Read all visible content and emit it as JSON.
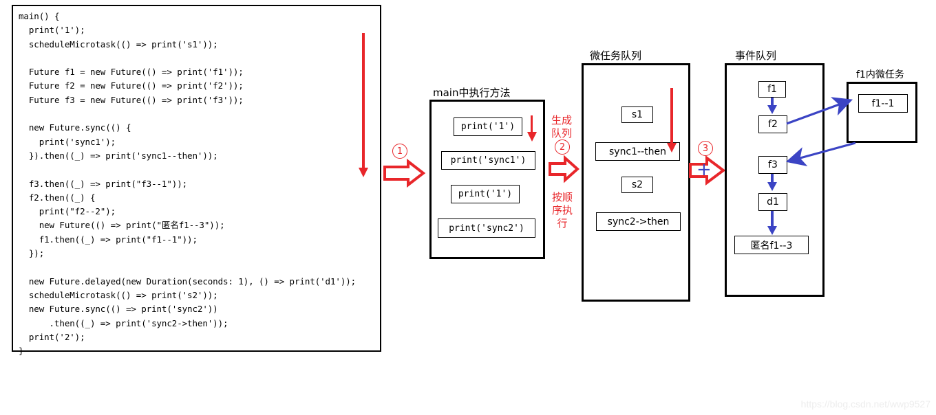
{
  "code_panel": {
    "name": "dart-event-loop-source-code",
    "code": "main() {\n  print('1');\n  scheduleMicrotask(() => print('s1'));\n\n  Future f1 = new Future(() => print('f1'));\n  Future f2 = new Future(() => print('f2'));\n  Future f3 = new Future(() => print('f3'));\n\n  new Future.sync(() {\n    print('sync1');\n  }).then((_) => print('sync1--then'));\n\n  f3.then((_) => print(\"f3--1\"));\n  f2.then((_) {\n    print(\"f2--2\");\n    new Future(() => print(\"匿名f1--3\"));\n    f1.then((_) => print(\"f1--1\"));\n  });\n\n  new Future.delayed(new Duration(seconds: 1), () => print('d1'));\n  scheduleMicrotask(() => print('s2'));\n  new Future.sync(() => print('sync2'))\n      .then((_) => print('sync2->then'));\n  print('2');\n}"
  },
  "main_exec": {
    "title": "main中执行方法",
    "items": [
      {
        "label": "print('1')"
      },
      {
        "label": "print('sync1')"
      },
      {
        "label": "print('1')"
      },
      {
        "label": "print('sync2')"
      }
    ]
  },
  "microtask_queue": {
    "title": "微任务队列",
    "items": [
      {
        "label": "s1"
      },
      {
        "label": "sync1--then"
      },
      {
        "label": "s2"
      },
      {
        "label": "sync2->then"
      }
    ]
  },
  "event_queue": {
    "title": "事件队列",
    "items": [
      {
        "label": "f1"
      },
      {
        "label": "f2"
      },
      {
        "label": "f3"
      },
      {
        "label": "d1"
      },
      {
        "label": "匿名f1--3"
      }
    ]
  },
  "f1_microtask": {
    "title": "f1内微任务",
    "items": [
      {
        "label": "f1--1"
      }
    ]
  },
  "annotations": {
    "step1": "①",
    "step1_num": "1",
    "step2_num": "2",
    "step3_num": "3",
    "note_generate": "生成\n队列",
    "note_step2": "②",
    "note_order": "按顺\n序执\n行"
  },
  "watermark": "https://blog.csdn.net/wwp9527",
  "colors": {
    "red": "#e8262a",
    "blue": "#3b44c4",
    "black": "#000000",
    "watermark": "#ededed"
  }
}
